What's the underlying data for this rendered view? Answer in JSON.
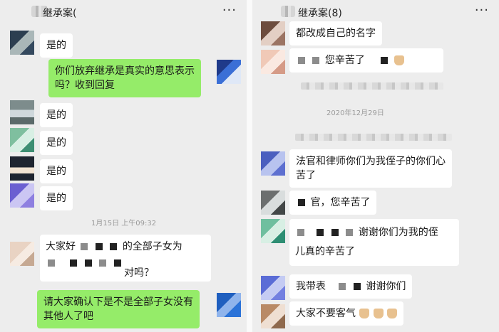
{
  "left": {
    "title": "继承案(",
    "more": "···",
    "messages": {
      "m1": "是的",
      "m2": "你们放弃继承是真实的意思表示\n吗？收到回复",
      "m3": "是的",
      "m4": "是的",
      "m5": "是的",
      "m6": "是的",
      "time": "1月15日 上午09:32",
      "m7a": "大家好",
      "m7b": "的全部子女为",
      "m7c": "对吗？",
      "m8": "请大家确认下是不是全部子女没有\n其他人了吧"
    }
  },
  "right": {
    "title": "继承案(8)",
    "more": "···",
    "messages": {
      "r1": "都改成自己的名字",
      "r2": "您辛苦了",
      "time": "2020年12月29日",
      "r3": "法官和律师你们为我侄子的你们心\n苦了",
      "r4": "官，您辛苦了",
      "r5a": "谢谢你们为我的侄",
      "r5b": "儿真的辛苦了",
      "r6a": "我带表",
      "r6b": "谢谢你们",
      "r7": "大家不要客气"
    }
  },
  "colors": {
    "background": "#ededed",
    "bubble_self": "#95ec69",
    "bubble_other": "#ffffff"
  },
  "icons": {
    "more": "more-dots-icon"
  }
}
